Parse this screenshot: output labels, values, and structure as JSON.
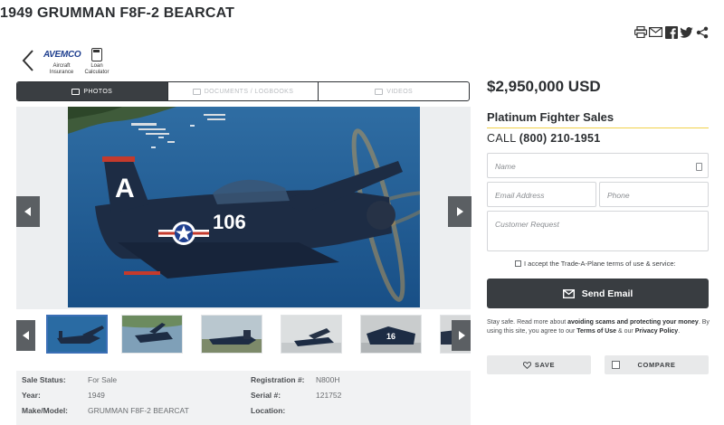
{
  "listing": {
    "title": "1949 GRUMMAN F8F-2 BEARCAT"
  },
  "share_icons": [
    "printer-icon",
    "email-icon",
    "facebook-icon",
    "twitter-icon",
    "share-icon"
  ],
  "partners": {
    "avemco": {
      "logo_text": "AVEMCO",
      "label_line1": "Aircraft",
      "label_line2": "Insurance"
    },
    "loan": {
      "label_line1": "Loan",
      "label_line2": "Calculator"
    }
  },
  "tabs": [
    {
      "label": "PHOTOS",
      "active": true,
      "icon": "photo-icon"
    },
    {
      "label": "DOCUMENTS / LOGBOOKS",
      "active": false,
      "icon": "document-icon"
    },
    {
      "label": "VIDEOS",
      "active": false,
      "icon": "video-icon"
    }
  ],
  "hero": {
    "tail_letter": "A",
    "fuselage_number": "106"
  },
  "thumbnails": {
    "count_visible": 6,
    "selected_index": 0
  },
  "specs": {
    "sale_status_label": "Sale Status:",
    "sale_status_value": "For Sale",
    "year_label": "Year:",
    "year_value": "1949",
    "make_model_label": "Make/Model:",
    "make_model_value": "GRUMMAN F8F-2 BEARCAT",
    "registration_label": "Registration #:",
    "registration_value": "N800H",
    "serial_label": "Serial #:",
    "serial_value": "121752",
    "location_label": "Location:",
    "location_value": ""
  },
  "sidebar": {
    "price": "$2,950,000 USD",
    "dealer": "Platinum Fighter Sales",
    "call_label": "CALL",
    "phone": "(800) 210-1951",
    "form": {
      "name_placeholder": "Name",
      "email_placeholder": "Email Address",
      "phone_placeholder": "Phone",
      "request_placeholder": "Customer Request",
      "terms_text": "I accept the Trade-A-Plane terms of use & service:",
      "send_label": "Send Email"
    },
    "notice": {
      "part1": "Stay safe. Read more about ",
      "link1": "avoiding scams and protecting your money",
      "part2": ". By using this site, you agree to our ",
      "link2": "Terms of Use",
      "part3": " & our ",
      "link3": "Privacy Policy",
      "part4": "."
    },
    "save_label": "SAVE",
    "compare_label": "COMPARE"
  },
  "colors": {
    "dark": "#393d41",
    "accent_line": "#f0d04a",
    "sea": "#1e5d94",
    "aircraft": "#1d2c44"
  }
}
